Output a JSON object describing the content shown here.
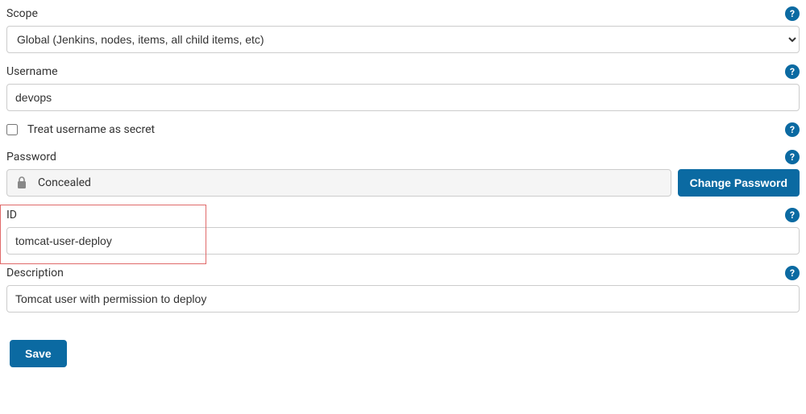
{
  "scope": {
    "label": "Scope",
    "selected": "Global (Jenkins, nodes, items, all child items, etc)"
  },
  "username": {
    "label": "Username",
    "value": "devops"
  },
  "treatSecret": {
    "label": "Treat username as secret",
    "checked": false
  },
  "password": {
    "label": "Password",
    "concealed_text": "Concealed",
    "change_button": "Change Password"
  },
  "id": {
    "label": "ID",
    "value": "tomcat-user-deploy"
  },
  "description": {
    "label": "Description",
    "value": "Tomcat user with permission to deploy"
  },
  "save_button": "Save"
}
